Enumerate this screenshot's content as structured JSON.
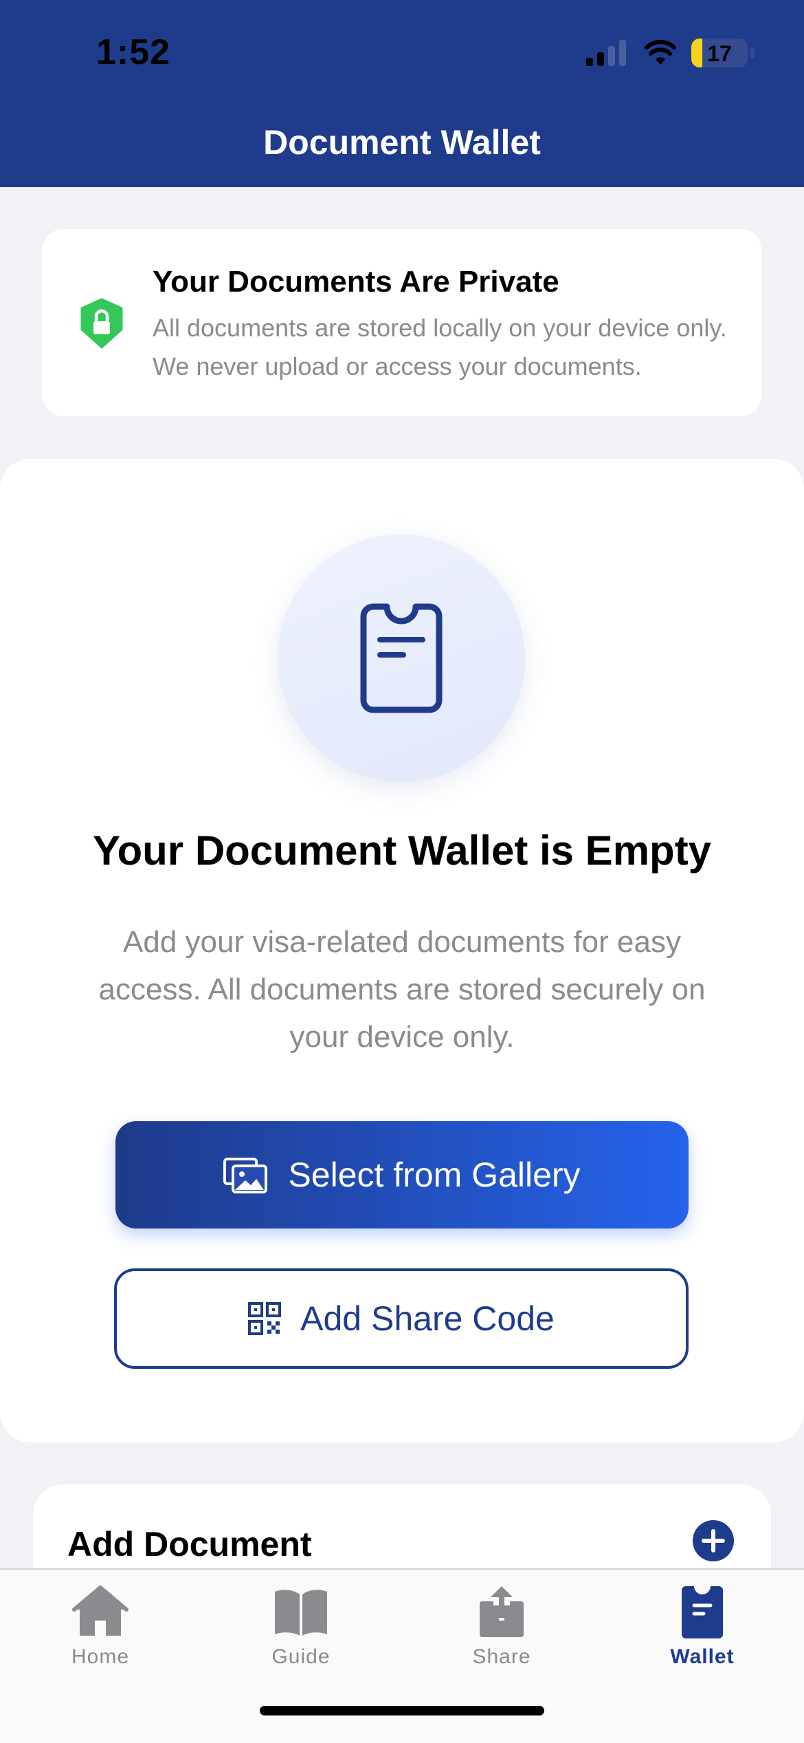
{
  "status_bar": {
    "time": "1:52",
    "battery": "17"
  },
  "header": {
    "title": "Document Wallet"
  },
  "privacy": {
    "title": "Your Documents Are Private",
    "text": "All documents are stored locally on your device only. We never upload or access your documents."
  },
  "empty_state": {
    "title": "Your Document Wallet is Empty",
    "description": "Add your visa-related documents for easy access. All documents are stored securely on your device only.",
    "gallery_button": "Select from Gallery",
    "share_code_button": "Add Share Code"
  },
  "add_document": {
    "title": "Add Document"
  },
  "tabs": [
    {
      "label": "Home",
      "icon": "home-icon",
      "active": false
    },
    {
      "label": "Guide",
      "icon": "book-icon",
      "active": false
    },
    {
      "label": "Share",
      "icon": "share-icon",
      "active": false
    },
    {
      "label": "Wallet",
      "icon": "wallet-icon",
      "active": true
    }
  ],
  "colors": {
    "brand": "#1f3b8c",
    "accent": "#2563eb",
    "success": "#34c759",
    "muted": "#8a8a8f"
  }
}
